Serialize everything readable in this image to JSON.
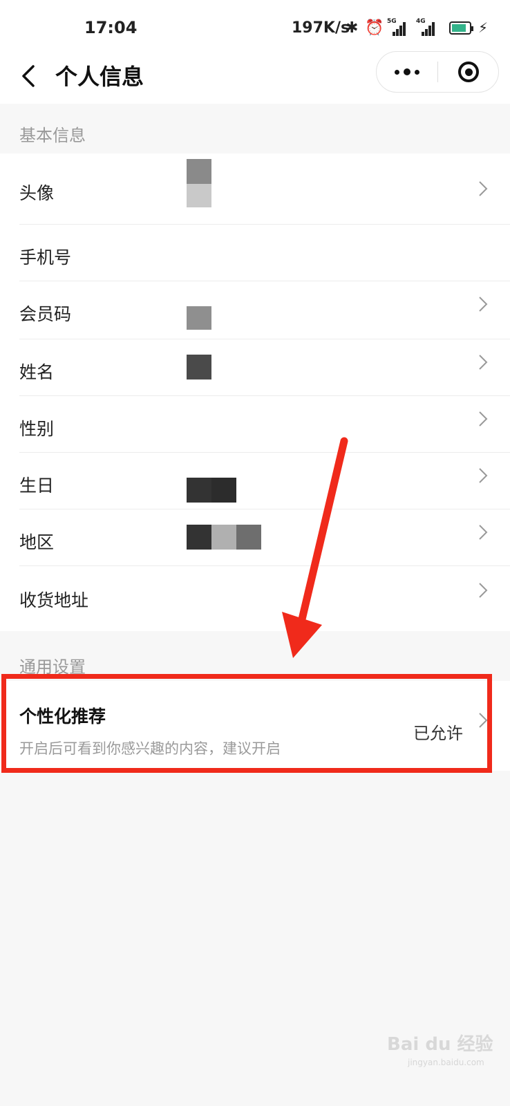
{
  "status_bar": {
    "time": "17:04",
    "speed": "197K/s",
    "signal1_label": "5G",
    "signal2_label": "4G"
  },
  "nav": {
    "title": "个人信息"
  },
  "sections": {
    "basic_title": "基本信息",
    "general_title": "通用设置"
  },
  "basic_rows": [
    {
      "label": "头像"
    },
    {
      "label": "手机号"
    },
    {
      "label": "会员码"
    },
    {
      "label": "姓名"
    },
    {
      "label": "性别"
    },
    {
      "label": "生日"
    },
    {
      "label": "地区"
    },
    {
      "label": "收货地址"
    }
  ],
  "personalized": {
    "label": "个性化推荐",
    "description": "开启后可看到你感兴趣的内容，建议开启",
    "value": "已允许"
  },
  "watermark": {
    "brand": "Bai du 经验",
    "url": "jingyan.baidu.com"
  },
  "colors": {
    "highlight": "#f02a1b",
    "battery": "#33b38a"
  }
}
